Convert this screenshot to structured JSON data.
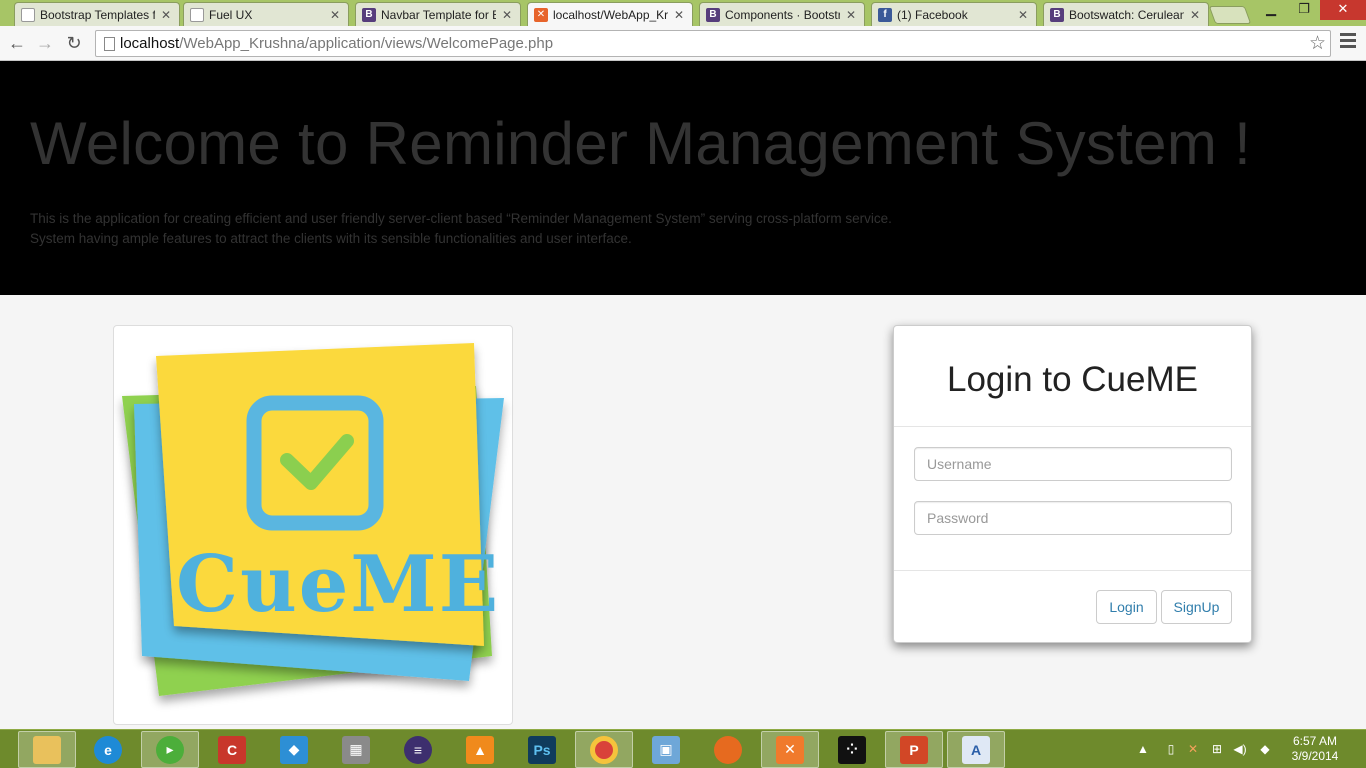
{
  "browser": {
    "tabs": [
      {
        "title": "Bootstrap Templates f",
        "favicon": "doc-icon",
        "active": false
      },
      {
        "title": "Fuel UX",
        "favicon": "doc-icon",
        "active": false
      },
      {
        "title": "Navbar Template for B",
        "favicon": "bootstrap-icon",
        "active": false
      },
      {
        "title": "localhost/WebApp_Kr",
        "favicon": "xampp-icon",
        "active": true
      },
      {
        "title": "Components · Bootstr",
        "favicon": "bootstrap-icon",
        "active": false
      },
      {
        "title": "(1) Facebook",
        "favicon": "facebook-icon",
        "active": false
      },
      {
        "title": "Bootswatch: Cerulean",
        "favicon": "bootstrap-icon",
        "active": false
      }
    ],
    "address": {
      "host": "localhost",
      "path": "/WebApp_Krushna/application/views/WelcomePage.php"
    }
  },
  "jumbotron": {
    "heading": "Welcome to Reminder Management System !",
    "line1": "This is the application for creating efficient and user friendly server-client based “Reminder Management System” serving cross-platform service.",
    "line2": "System having ample features to attract the clients with its sensible functionalities and user interface."
  },
  "logo": {
    "text": "CueME"
  },
  "login": {
    "title": "Login to CueME",
    "username_placeholder": "Username",
    "password_placeholder": "Password",
    "login_label": "Login",
    "signup_label": "SignUp"
  },
  "taskbar": {
    "time": "6:57 AM",
    "date": "3/9/2014",
    "apps": [
      "file-explorer-icon",
      "internet-explorer-icon",
      "camtasia-icon",
      "ccleaner-icon",
      "dropbox-icon",
      "firewall-icon",
      "eclipse-icon",
      "vlc-icon",
      "photoshop-icon",
      "chrome-icon",
      "virtualbox-icon",
      "firefox-icon",
      "xampp-icon",
      "blackberry-icon",
      "powerpoint-icon",
      "wordpad-icon"
    ]
  },
  "colors": {
    "tabstrip": "#a7c566",
    "jumbotron_bg": "#000000",
    "link_blue": "#317eac",
    "taskbar": "#6e8a2c"
  }
}
